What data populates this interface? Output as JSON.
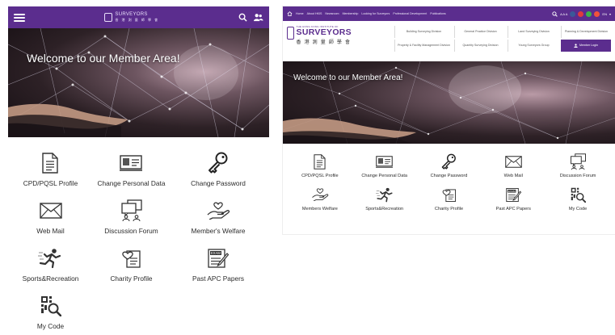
{
  "mobile": {
    "logo": {
      "name": "SURVEYORS",
      "sub": "香 港 測 量 師 學 會"
    },
    "icons": {
      "menu": "hamburger-icon",
      "search": "search-icon",
      "user": "user-group-icon"
    },
    "banner_text": "Welcome to our Member Area!",
    "tiles": [
      {
        "label": "CPD/PQSL Profile",
        "icon": "document-icon"
      },
      {
        "label": "Change Personal Data",
        "icon": "id-card-icon"
      },
      {
        "label": "Change Password",
        "icon": "key-icon"
      },
      {
        "label": "Web Mail",
        "icon": "envelope-icon"
      },
      {
        "label": "Discussion Forum",
        "icon": "forum-icon"
      },
      {
        "label": "Member's Welfare",
        "icon": "hand-heart-icon"
      },
      {
        "label": "Sports&Recreation",
        "icon": "runner-icon"
      },
      {
        "label": "Charity Profile",
        "icon": "charity-icon"
      },
      {
        "label": "Past APC Papers",
        "icon": "exam-icon"
      },
      {
        "label": "My Code",
        "icon": "qr-search-icon"
      }
    ]
  },
  "desktop": {
    "topnav": [
      "Home",
      "About HKIS",
      "Newsroom",
      "Membership",
      "Looking for Surveyors",
      "Professional Development",
      "Publications"
    ],
    "tools": {
      "font_sizes": "A A A",
      "lang": "EN"
    },
    "brand": {
      "line1": "THE HONG KONG INSTITUTE OF",
      "name": "SURVEYORS",
      "chinese": "香 港 測 量 師 學 會"
    },
    "divisions": [
      "Building Surveying Division",
      "General Practice Division",
      "Land Surveying Division",
      "Planning & Development Division",
      "Property & Facility Management Division",
      "Quantity Surveying Division",
      "Young Surveyors Group",
      "Member Login"
    ],
    "banner_text": "Welcome to our Member Area!",
    "tiles": [
      {
        "label": "CPD/PQSL Profile",
        "icon": "document-icon"
      },
      {
        "label": "Change Personal Data",
        "icon": "id-card-icon"
      },
      {
        "label": "Change Password",
        "icon": "key-icon"
      },
      {
        "label": "Web Mail",
        "icon": "envelope-icon"
      },
      {
        "label": "Discussion Forum",
        "icon": "forum-icon"
      },
      {
        "label": "Members Welfare",
        "icon": "hand-heart-icon"
      },
      {
        "label": "Sports&Recreation",
        "icon": "runner-icon"
      },
      {
        "label": "Charity Profile",
        "icon": "charity-icon"
      },
      {
        "label": "Past APC Papers",
        "icon": "exam-icon"
      },
      {
        "label": "My Code",
        "icon": "qr-search-icon"
      }
    ]
  },
  "colors": {
    "brand_purple": "#5b2d8e",
    "social_facebook": "#3b5998",
    "social_youtube": "#e0393e",
    "social_wechat": "#3bb44a",
    "social_weibo": "#f0523a"
  }
}
